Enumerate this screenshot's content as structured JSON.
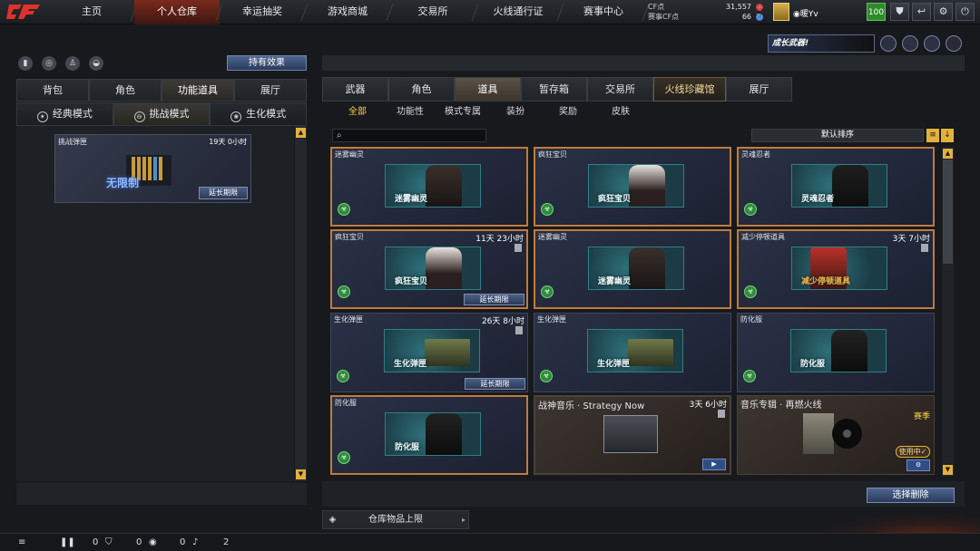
{
  "topbar": {
    "logo_text": "CF",
    "nav": [
      "主页",
      "个人仓库",
      "幸运抽奖",
      "游戏商城",
      "交易所",
      "火线通行证",
      "赛事中心"
    ],
    "active_nav": 1,
    "cf_points_label": "CF点",
    "cf_points": "31,557",
    "match_points_label": "赛事CF点",
    "match_points": "66",
    "plus_icon": "+",
    "refresh_icon": "↻",
    "username": "◉暖Yv",
    "level": "100",
    "buttons": [
      "shield-icon",
      "back-icon",
      "gear-icon",
      "power-icon"
    ]
  },
  "left": {
    "icons": [
      "ranking-icon",
      "compass-icon",
      "character-icon",
      "bag-icon"
    ],
    "effect_button": "持有效果",
    "tabs": [
      "背包",
      "角色",
      "功能道具",
      "展厅"
    ],
    "active_tab": 2,
    "modes": [
      {
        "label": "经典模式",
        "icon": "✶"
      },
      {
        "label": "挑战模式",
        "icon": "⊖"
      },
      {
        "label": "生化模式",
        "icon": "❀"
      }
    ],
    "active_mode": 1,
    "card": {
      "name": "挑战弹匣",
      "time": "19天 0小时",
      "image_text": "无限制",
      "extend": "延长期限"
    }
  },
  "right": {
    "banner": "成长武器!",
    "tabs": [
      "武器",
      "角色",
      "道具",
      "暂存箱",
      "交易所",
      "火线珍藏馆",
      "展厅"
    ],
    "active_tab": 2,
    "subtabs": [
      "全部",
      "功能性",
      "模式专属",
      "装扮",
      "奖励",
      "皮肤"
    ],
    "active_subtab": 0,
    "search_placeholder": "",
    "sort_label": "默认排序",
    "items": [
      {
        "name": "迷雾幽灵",
        "time": "",
        "tag": "迷雾幽灵",
        "extend": "",
        "style": "zombie"
      },
      {
        "name": "疯狂宝贝",
        "time": "",
        "tag": "疯狂宝贝",
        "extend": "",
        "style": "zombie"
      },
      {
        "name": "灵魂忍者",
        "time": "",
        "tag": "灵魂忍者",
        "extend": "",
        "style": "zombie"
      },
      {
        "name": "疯狂宝贝",
        "time": "11天 23小时",
        "tag": "疯狂宝贝",
        "extend": "延长期限",
        "style": "zombie"
      },
      {
        "name": "迷雾幽灵",
        "time": "",
        "tag": "迷雾幽灵",
        "extend": "",
        "style": "zombie"
      },
      {
        "name": "减少停顿道具",
        "time": "3天 7小时",
        "tag": "减少停顿道具",
        "extend": "",
        "style": "robot"
      },
      {
        "name": "生化弹匣",
        "time": "26天 8小时",
        "tag": "生化弹匣",
        "extend": "延长期限",
        "style": "box"
      },
      {
        "name": "生化弹匣",
        "time": "",
        "tag": "生化弹匣",
        "extend": "",
        "style": "box"
      },
      {
        "name": "防化服",
        "time": "",
        "tag": "防化服",
        "extend": "",
        "style": "vest"
      },
      {
        "name": "防化服",
        "time": "",
        "tag": "防化服",
        "extend": "",
        "style": "vest"
      },
      {
        "name": "战神音乐 · Strategy Now",
        "time": "3天 6小时",
        "tag": "",
        "extend": "",
        "style": "tape",
        "button": "▶"
      },
      {
        "name": "音乐专辑 · 再燃火线",
        "time": "",
        "tag": "",
        "extend": "",
        "style": "album",
        "season": "赛季",
        "in_use": "使用中✓",
        "button": "⚙"
      }
    ],
    "delete_button": "选择删除",
    "limit_label": "仓库物品上限"
  },
  "status": {
    "list_icon": "≡",
    "count1": "0",
    "count2": "0",
    "count3": "0",
    "count4": "2"
  },
  "colors": {
    "accent": "#e3b13b",
    "active_nav": "#7a2a1c",
    "blue_button": "#3a5080",
    "select_border": "#c07b3c"
  }
}
